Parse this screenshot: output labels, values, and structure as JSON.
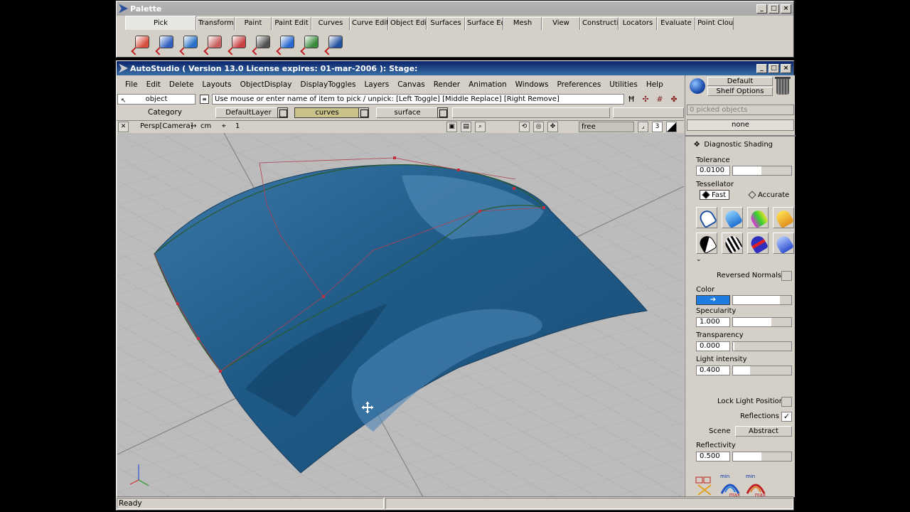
{
  "palette": {
    "title": "Palette",
    "tabs": [
      "Pick",
      "Transform",
      "Paint",
      "Paint Edit",
      "Curves",
      "Curve Edit",
      "Object Edit",
      "Surfaces",
      "Surface Edit",
      "Mesh",
      "View",
      "Construction",
      "Locators",
      "Evaluate",
      "Point Clouds"
    ],
    "active_tab": "Pick",
    "tools": [
      {
        "name": "pick-object-icon",
        "color": "#d85040"
      },
      {
        "name": "pick-component-icon",
        "color": "#3060c0"
      },
      {
        "name": "pick-cv-icon",
        "color": "#2a70c8"
      },
      {
        "name": "pick-template-icon",
        "color": "#c86060"
      },
      {
        "name": "pick-curve-icon",
        "color": "#c84040"
      },
      {
        "name": "pick-curve-on-surface-icon",
        "color": "#505050"
      },
      {
        "name": "pick-surface-icon",
        "color": "#2a6ad0"
      },
      {
        "name": "pick-point-icon",
        "color": "#3a8a3a"
      },
      {
        "name": "pick-nothing-icon",
        "color": "#2050a0"
      }
    ]
  },
  "main": {
    "title": "AutoStudio ( Version 13.0  License expires: 01-mar-2006 ): Stage:",
    "menu": [
      "File",
      "Edit",
      "Delete",
      "Layouts",
      "ObjectDisplay",
      "DisplayToggles",
      "Layers",
      "Canvas",
      "Render",
      "Animation",
      "Windows",
      "Preferences",
      "Utilities",
      "Help"
    ],
    "pick_mode": "object",
    "prompt": "Use mouse or enter name of item to pick / unpick: [Left Toggle] [Middle Replace] [Right Remove]",
    "category_label": "Category",
    "layers": [
      {
        "name": "DefaultLayer",
        "active": false
      },
      {
        "name": "curves",
        "active": true
      },
      {
        "name": "surface",
        "active": false
      }
    ],
    "view": {
      "camera": "Persp[Camera]",
      "units": "cm",
      "grid": "1",
      "mode": "free",
      "count": "3"
    },
    "status": "Ready"
  },
  "right_panel": {
    "shelf_default": "Default",
    "shelf_options": "Shelf Options",
    "picked": "0 picked objects",
    "selection": "none",
    "section_title": "Diagnostic Shading",
    "tolerance_label": "Tolerance",
    "tolerance_value": "0.0100",
    "tessellator_label": "Tessellator",
    "tess_fast": "Fast",
    "tess_accurate": "Accurate",
    "reversed_normals_label": "Reversed Normals",
    "color_label": "Color",
    "specularity_label": "Specularity",
    "specularity_value": "1.000",
    "transparency_label": "Transparency",
    "transparency_value": "0.000",
    "light_intensity_label": "Light intensity",
    "light_intensity_value": "0.400",
    "lock_light_label": "Lock Light Position",
    "reflections_label": "Reflections",
    "reflections_checked": true,
    "scene_label": "Scene",
    "scene_value": "Abstract",
    "reflectivity_label": "Reflectivity",
    "reflectivity_value": "0.500",
    "min_label": "min",
    "max_label": "max"
  },
  "colors": {
    "surface_blue": "#1f5a86",
    "viewport_bg": "#bcbcbc",
    "accent": "#0a246a"
  }
}
